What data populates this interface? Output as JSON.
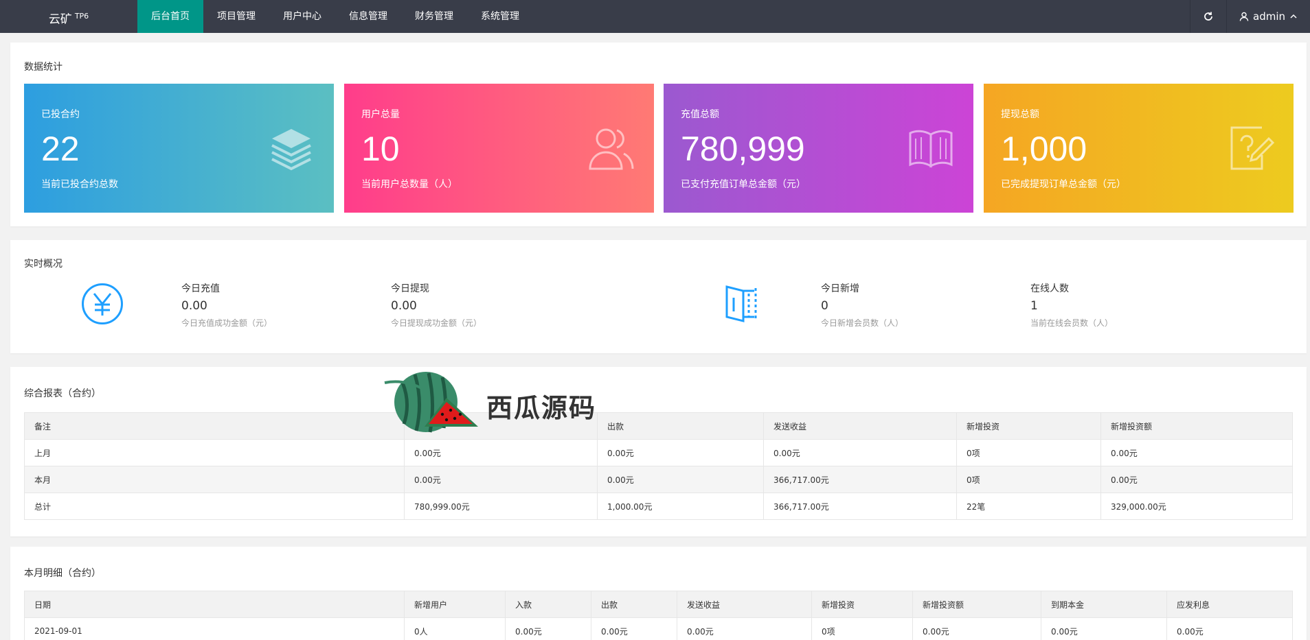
{
  "topbar": {
    "logo": "云矿",
    "logo_sup": "TP6",
    "nav": [
      "后台首页",
      "项目管理",
      "用户中心",
      "信息管理",
      "财务管理",
      "系统管理"
    ],
    "user": "admin"
  },
  "stats": {
    "title": "数据统计",
    "boxes": [
      {
        "label": "已投合约",
        "value": "22",
        "sub": "当前已投合约总数",
        "icon": "layers-icon"
      },
      {
        "label": "用户总量",
        "value": "10",
        "sub": "当前用户总数量（人）",
        "icon": "users-icon"
      },
      {
        "label": "充值总额",
        "value": "780,999",
        "sub": "已支付充值订单总金额（元）",
        "icon": "book-icon"
      },
      {
        "label": "提现总额",
        "value": "1,000",
        "sub": "已完成提现订单总金额（元）",
        "icon": "edit-question-icon"
      }
    ]
  },
  "realtime": {
    "title": "实时概况",
    "items": [
      {
        "t": "今日充值",
        "v": "0.00",
        "s": "今日充值成功金额（元）"
      },
      {
        "t": "今日提现",
        "v": "0.00",
        "s": "今日提现成功金额（元）"
      },
      {
        "t": "今日新增",
        "v": "0",
        "s": "今日新增会员数（人）"
      },
      {
        "t": "在线人数",
        "v": "1",
        "s": "当前在线会员数（人）"
      }
    ]
  },
  "report": {
    "title": "综合报表（合约）",
    "headers": [
      "备注",
      "入款",
      "出款",
      "发送收益",
      "新增投资",
      "新增投资额"
    ],
    "rows": [
      [
        "上月",
        "0.00元",
        "0.00元",
        "0.00元",
        "0项",
        "0.00元"
      ],
      [
        "本月",
        "0.00元",
        "0.00元",
        "366,717.00元",
        "0项",
        "0.00元"
      ],
      [
        "总计",
        "780,999.00元",
        "1,000.00元",
        "366,717.00元",
        "22笔",
        "329,000.00元"
      ]
    ]
  },
  "monthly": {
    "title": "本月明细（合约）",
    "headers": [
      "日期",
      "新增用户",
      "入款",
      "出款",
      "发送收益",
      "新增投资",
      "新增投资额",
      "到期本金",
      "应发利息"
    ],
    "rows": [
      [
        "2021-09-01",
        "0人",
        "0.00元",
        "0.00元",
        "0.00元",
        "0项",
        "0.00元",
        "0.00元",
        "0.00元"
      ]
    ]
  },
  "watermark": {
    "text": "西瓜源码"
  }
}
